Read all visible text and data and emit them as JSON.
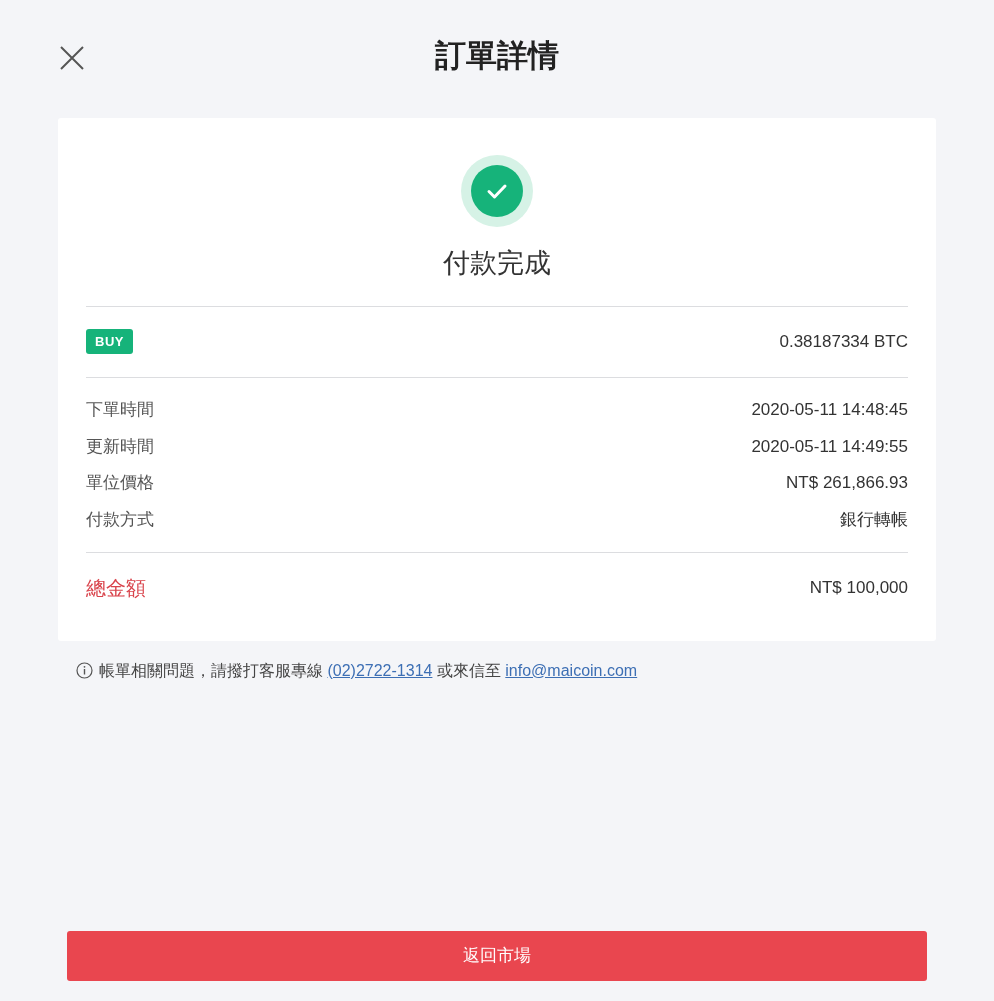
{
  "header": {
    "title": "訂單詳情"
  },
  "status": {
    "text": "付款完成"
  },
  "order": {
    "side": "BUY",
    "amount": "0.38187334 BTC"
  },
  "details": [
    {
      "label": "下單時間",
      "value": "2020-05-11 14:48:45"
    },
    {
      "label": "更新時間",
      "value": "2020-05-11 14:49:55"
    },
    {
      "label": "單位價格",
      "value": "NT$ 261,866.93"
    },
    {
      "label": "付款方式",
      "value": "銀行轉帳"
    }
  ],
  "total": {
    "label": "總金額",
    "value": "NT$ 100,000"
  },
  "note": {
    "before": "帳單相關問題，請撥打客服專線",
    "phone": "(02)2722-1314",
    "middle": "或來信至",
    "email": "info@maicoin.com"
  },
  "button": {
    "label": "返回市場"
  }
}
